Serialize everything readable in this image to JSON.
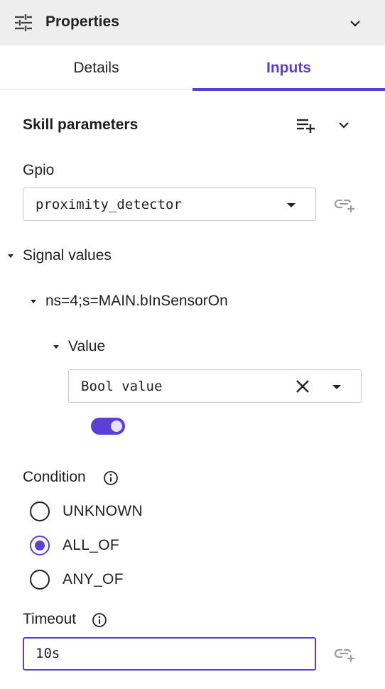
{
  "header": {
    "title": "Properties",
    "settings_icon": "tune-sliders-icon",
    "collapse_icon": "chevron-down-icon"
  },
  "tabs": [
    {
      "label": "Details",
      "active": false
    },
    {
      "label": "Inputs",
      "active": true
    }
  ],
  "skill_parameters": {
    "title": "Skill parameters",
    "add_icon": "playlist-add-icon",
    "expand_icon": "chevron-down-icon"
  },
  "gpio": {
    "label": "Gpio",
    "value": "proximity_detector",
    "link_icon": "add-link-icon"
  },
  "signal_values": {
    "label": "Signal values",
    "node": {
      "label": "ns=4;s=MAIN.bInSensorOn",
      "value_label": "Value",
      "type_value": "Bool value",
      "clear_icon": "close-icon",
      "bool_on": true
    }
  },
  "condition": {
    "label": "Condition",
    "info_icon": "info-icon",
    "options": [
      {
        "label": "UNKNOWN",
        "selected": false
      },
      {
        "label": "ALL_OF",
        "selected": true
      },
      {
        "label": "ANY_OF",
        "selected": false
      }
    ]
  },
  "timeout": {
    "label": "Timeout",
    "info_icon": "info-icon",
    "value": "10s",
    "link_icon": "add-link-icon"
  },
  "colors": {
    "accent": "#5b3fd9",
    "header_bg": "#eeeeee"
  }
}
